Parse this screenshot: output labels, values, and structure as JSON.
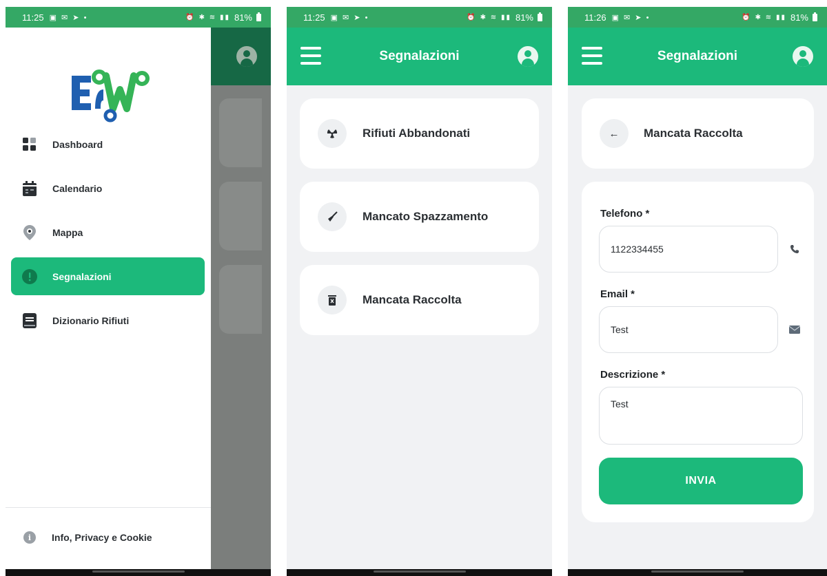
{
  "colors": {
    "primary": "#1cb97b",
    "statusbar": "#34a865",
    "text": "#2b2f33",
    "background": "#f1f2f4"
  },
  "screens": [
    {
      "statusbar": {
        "time": "11:25",
        "battery": "81%"
      },
      "drawer": {
        "logo": "EW",
        "items": [
          {
            "label": "Dashboard",
            "icon": "dashboard-grid-icon"
          },
          {
            "label": "Calendario",
            "icon": "calendar-icon"
          },
          {
            "label": "Mappa",
            "icon": "map-pin-icon"
          },
          {
            "label": "Segnalazioni",
            "icon": "alert-circle-icon",
            "active": true
          },
          {
            "label": "Dizionario Rifiuti",
            "icon": "book-icon"
          }
        ],
        "footer": {
          "label": "Info, Privacy e Cookie",
          "icon": "info-icon"
        }
      }
    },
    {
      "statusbar": {
        "time": "11:25",
        "battery": "81%"
      },
      "appbar": {
        "title": "Segnalazioni"
      },
      "categories": [
        {
          "label": "Rifiuti Abbandonati",
          "icon": "radiation-icon"
        },
        {
          "label": "Mancato Spazzamento",
          "icon": "broom-icon"
        },
        {
          "label": "Mancata Raccolta",
          "icon": "trash-x-icon"
        }
      ]
    },
    {
      "statusbar": {
        "time": "11:26",
        "battery": "81%"
      },
      "appbar": {
        "title": "Segnalazioni"
      },
      "header": {
        "title": "Mancata Raccolta",
        "back_icon": "arrow-left-icon"
      },
      "form": {
        "phone": {
          "label": "Telefono *",
          "value": "1122334455",
          "icon": "phone-icon"
        },
        "email": {
          "label": "Email *",
          "value": "Test",
          "icon": "envelope-icon"
        },
        "description": {
          "label": "Descrizione *",
          "value": "Test"
        },
        "submit_label": "INVIA"
      }
    }
  ]
}
